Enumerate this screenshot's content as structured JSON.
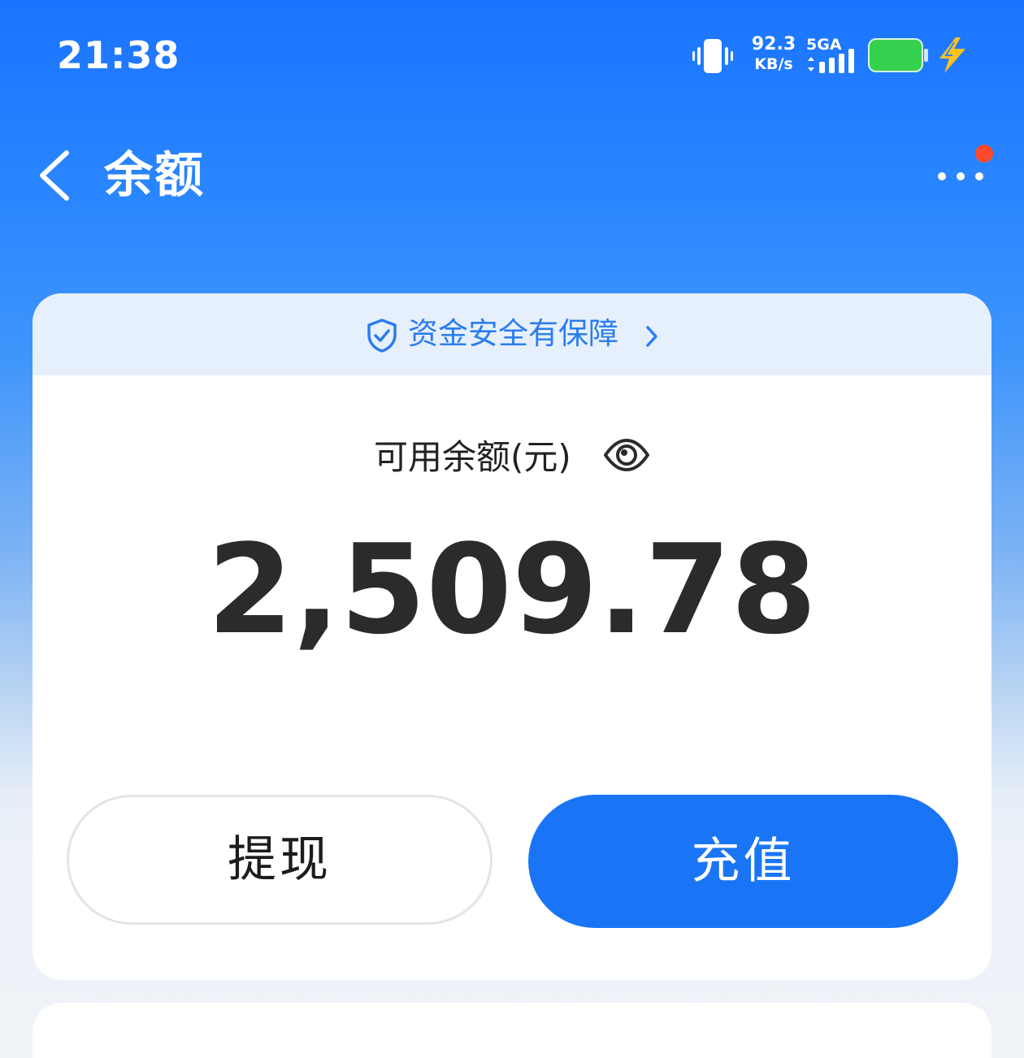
{
  "status_bar": {
    "time": "21:38",
    "net_speed_value": "92.3",
    "net_speed_unit": "KB/s",
    "network_type": "5GA",
    "icons": [
      "vibrate-icon",
      "signal-icon",
      "battery-icon",
      "charging-icon"
    ],
    "battery_color": "#35d14f",
    "charging_color": "#ffc21a"
  },
  "nav": {
    "title": "余额",
    "back_icon": "back-chevron-icon",
    "more_icon": "more-dots-icon",
    "notification_dot_color": "#ff4a2e"
  },
  "balance_card": {
    "security_banner_text": "资金安全有保障",
    "security_icon": "shield-check-icon",
    "balance_label": "可用余额(元)",
    "visibility_icon": "eye-icon",
    "balance_amount": "2,509.78",
    "withdraw_label": "提现",
    "recharge_label": "充值"
  },
  "colors": {
    "header_blue": "#1b74ff",
    "accent_blue": "#1a75f6",
    "banner_bg": "#e6f0fd",
    "banner_text": "#2b7cf0"
  }
}
